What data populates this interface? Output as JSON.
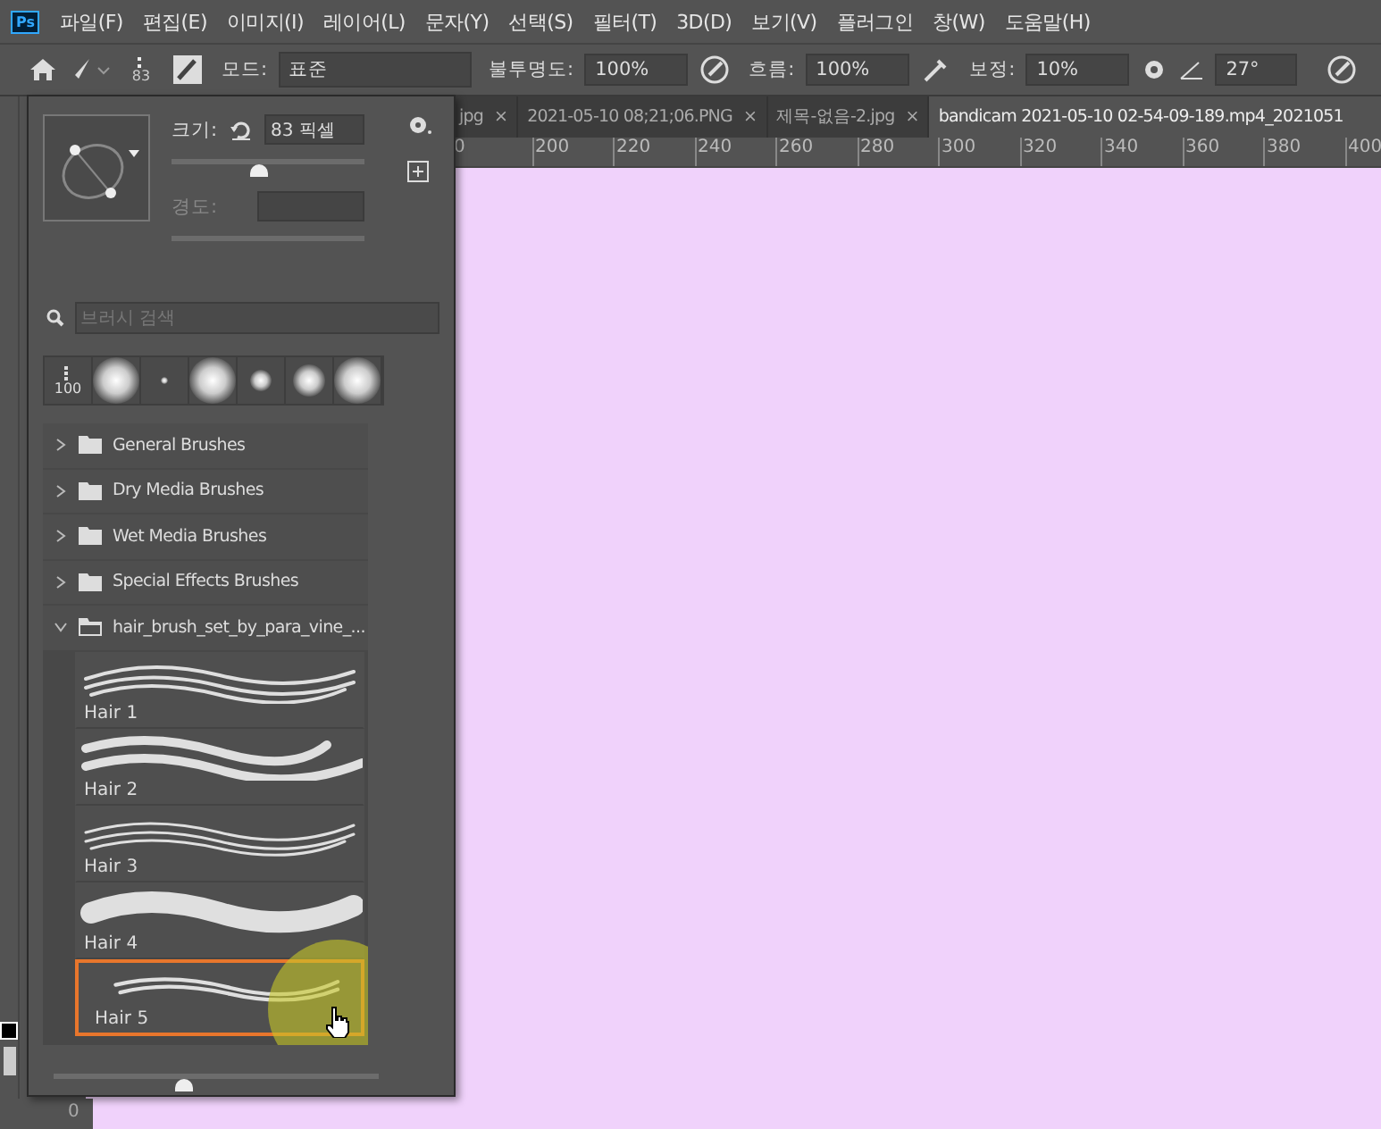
{
  "app_logo": "Ps",
  "menu_bar": [
    "파일(F)",
    "편집(E)",
    "이미지(I)",
    "레이어(L)",
    "문자(Y)",
    "선택(S)",
    "필터(T)",
    "3D(D)",
    "보기(V)",
    "플러그인",
    "창(W)",
    "도움말(H)"
  ],
  "options_bar": {
    "brush_size": "83",
    "mode_label": "모드:",
    "mode_value": "표준",
    "opacity_label": "불투명도:",
    "opacity_value": "100%",
    "flow_label": "흐름:",
    "flow_value": "100%",
    "smoothing_label": "보정:",
    "smoothing_value": "10%",
    "angle_value": "27°"
  },
  "document_tabs": [
    {
      "label": "jpg",
      "close": "×",
      "selected": false
    },
    {
      "label": "2021-05-10 08;21;06.PNG",
      "close": "×",
      "selected": false
    },
    {
      "label": "제목-없음-2.jpg",
      "close": "×",
      "selected": false
    },
    {
      "label": "bandicam 2021-05-10 02-54-09-189.mp4_2021051",
      "selected": true
    }
  ],
  "ruler_ticks": [
    "0",
    "200",
    "220",
    "240",
    "260",
    "280",
    "300",
    "320",
    "340",
    "360",
    "380",
    "400"
  ],
  "brush_panel": {
    "size_label": "크기:",
    "size_value": "83 픽셀",
    "size_slider": {
      "level": 0.45
    },
    "hardness_label": "경도:",
    "hardness_slider": {
      "disabled": true
    },
    "search_placeholder": "브러시 검색",
    "tip_size_label": "100",
    "folders": [
      {
        "name": "General Brushes",
        "expanded": false
      },
      {
        "name": "Dry Media Brushes",
        "expanded": false
      },
      {
        "name": "Wet Media Brushes",
        "expanded": false
      },
      {
        "name": "Special Effects Brushes",
        "expanded": false
      },
      {
        "name": "hair_brush_set_by_para_vine_...",
        "expanded": true
      }
    ],
    "brushes": [
      {
        "name": "Hair 1",
        "selected": false
      },
      {
        "name": "Hair 2",
        "selected": false
      },
      {
        "name": "Hair 3",
        "selected": false
      },
      {
        "name": "Hair 4",
        "selected": false
      },
      {
        "name": "Hair 5",
        "selected": true
      }
    ],
    "preview_slider": {
      "level": 0.4
    }
  },
  "status_bar": {
    "zoom": "0"
  }
}
